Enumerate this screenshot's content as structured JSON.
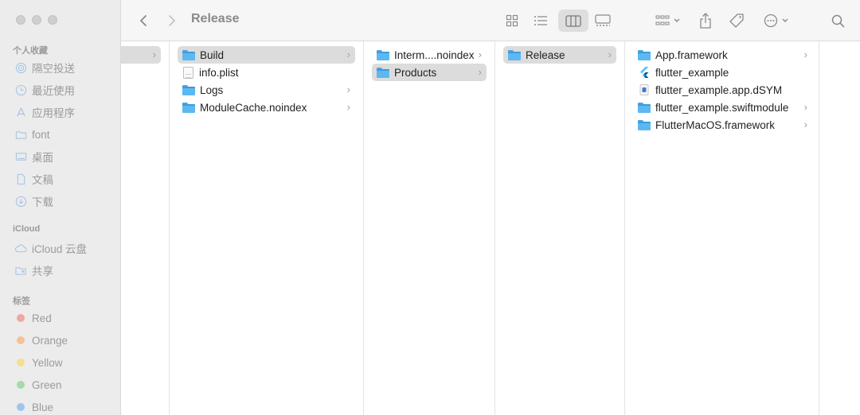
{
  "window": {
    "title": "Release"
  },
  "sidebar": {
    "favorites_heading": "个人收藏",
    "favorites": [
      {
        "label": "隔空投送",
        "icon": "airdrop-icon"
      },
      {
        "label": "最近使用",
        "icon": "clock-icon"
      },
      {
        "label": "应用程序",
        "icon": "applications-icon"
      },
      {
        "label": "font",
        "icon": "folder-icon"
      },
      {
        "label": "桌面",
        "icon": "desktop-icon"
      },
      {
        "label": "文稿",
        "icon": "document-icon"
      },
      {
        "label": "下载",
        "icon": "download-icon"
      }
    ],
    "icloud_heading": "iCloud",
    "icloud": [
      {
        "label": "iCloud 云盘",
        "icon": "cloud-icon"
      },
      {
        "label": "共享",
        "icon": "shared-folder-icon"
      }
    ],
    "tags_heading": "标签",
    "tags": [
      {
        "label": "Red",
        "color": "#f0a7a2"
      },
      {
        "label": "Orange",
        "color": "#f3c393"
      },
      {
        "label": "Yellow",
        "color": "#f3e08f"
      },
      {
        "label": "Green",
        "color": "#a6dba8"
      },
      {
        "label": "Blue",
        "color": "#9fc5ef"
      }
    ]
  },
  "columns": [
    {
      "items": [
        {
          "label": "",
          "type": "folder",
          "selected": true,
          "has_children": true
        }
      ]
    },
    {
      "items": [
        {
          "label": "Build",
          "type": "folder",
          "selected": true,
          "has_children": true
        },
        {
          "label": "info.plist",
          "type": "file",
          "selected": false,
          "has_children": false
        },
        {
          "label": "Logs",
          "type": "folder",
          "selected": false,
          "has_children": true
        },
        {
          "label": "ModuleCache.noindex",
          "type": "folder",
          "selected": false,
          "has_children": true
        }
      ]
    },
    {
      "items": [
        {
          "label": "Interm....noindex",
          "type": "folder",
          "selected": false,
          "has_children": true
        },
        {
          "label": "Products",
          "type": "folder",
          "selected": true,
          "has_children": true
        }
      ]
    },
    {
      "items": [
        {
          "label": "Release",
          "type": "folder",
          "selected": true,
          "has_children": true
        }
      ]
    },
    {
      "items": [
        {
          "label": "App.framework",
          "type": "folder",
          "selected": false,
          "has_children": true
        },
        {
          "label": "flutter_example",
          "type": "flutter-app",
          "selected": false,
          "has_children": false
        },
        {
          "label": "flutter_example.app.dSYM",
          "type": "dsym",
          "selected": false,
          "has_children": false
        },
        {
          "label": "flutter_example.swiftmodule",
          "type": "folder",
          "selected": false,
          "has_children": true
        },
        {
          "label": "FlutterMacOS.framework",
          "type": "folder",
          "selected": false,
          "has_children": true
        }
      ]
    }
  ],
  "colors": {
    "folder_blue": "#5bb8f1",
    "selection_gray": "#dcdcdc",
    "sidebar_bg": "#ececec"
  }
}
